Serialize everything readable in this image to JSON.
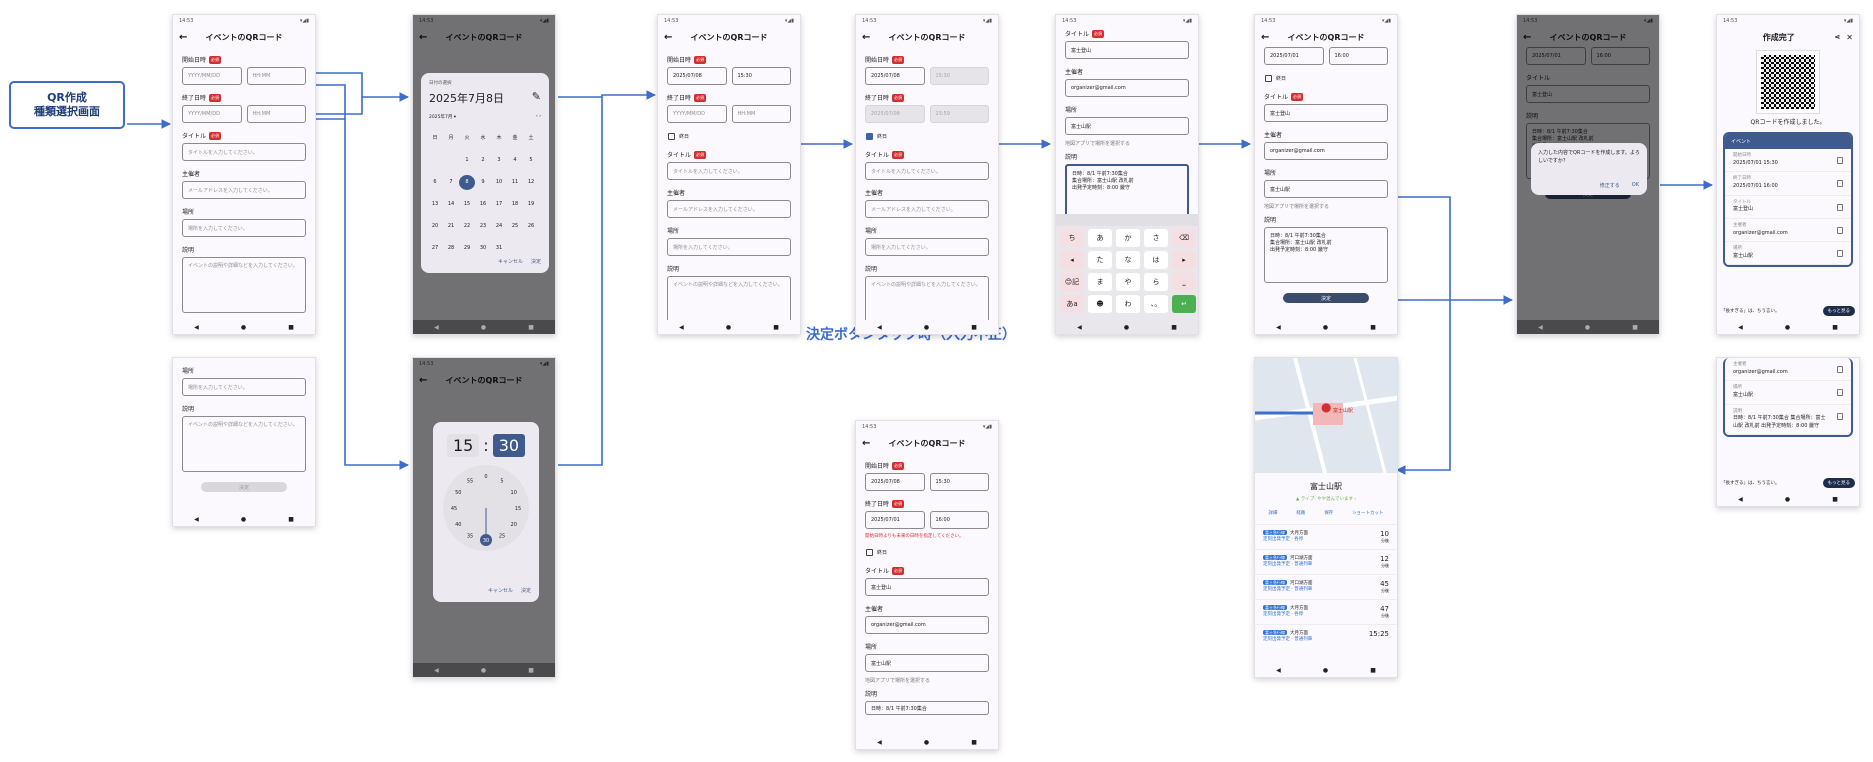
{
  "start_label": [
    "QR作成",
    "種類選択画面"
  ],
  "note": "決定ボタンタップ時（入力不正）",
  "common": {
    "status_time": "14:53",
    "title": "イベントのQRコード",
    "back": "←",
    "nav": [
      "◀",
      "●",
      "■"
    ],
    "required": "必須",
    "start_label": "開始日時",
    "end_label": "終了日時",
    "title_label": "タイトル",
    "organizer_label": "主催者",
    "place_label": "場所",
    "desc_label": "説明",
    "allday": "終日",
    "maplink": "地図アプリで場所を選択する",
    "date_ph": "YYYY/MM/DD",
    "time_ph": "HH:MM",
    "title_ph": "タイトルを入力してください。",
    "org_ph": "メールアドレスを入力してください。",
    "place_ph": "場所を入力してください。",
    "desc_ph": "イベントの説明や詳細などを入力してください。",
    "decide": "決定"
  },
  "values": {
    "start_date": "2025/07/08",
    "start_time": "15:30",
    "end_date": "2025/07/08",
    "end_time": "23:59",
    "end_date_bad": "2025/07/01",
    "end_time_bad": "16:00",
    "title": "富士登山",
    "organizer": "organizer@gmail.com",
    "place": "富士山駅",
    "desc": [
      "日時：8/1 午前7:30集合",
      "集合場所：富士山駅 改札前",
      "出発予定時刻：8:00 厳守"
    ],
    "error": "開始日時よりも未来の日時を指定してください。",
    "desc_short": "日時：8/1 午前7:30集合"
  },
  "date_picker": {
    "heading": "日付の選択",
    "date": "2025年7月8日",
    "month": "2025年7月 ▾",
    "weekdays": [
      "日",
      "月",
      "火",
      "水",
      "木",
      "金",
      "土"
    ],
    "weeks": [
      [
        "",
        "",
        "1",
        "2",
        "3",
        "4",
        "5"
      ],
      [
        "6",
        "7",
        "8",
        "9",
        "10",
        "11",
        "12"
      ],
      [
        "13",
        "14",
        "15",
        "16",
        "17",
        "18",
        "19"
      ],
      [
        "20",
        "21",
        "22",
        "23",
        "24",
        "25",
        "26"
      ],
      [
        "27",
        "28",
        "29",
        "30",
        "31",
        "",
        ""
      ]
    ],
    "selected": "8",
    "cancel": "キャンセル",
    "ok": "決定"
  },
  "time_picker": {
    "hour": "15",
    "minute": "30",
    "dial": [
      "0",
      "5",
      "10",
      "15",
      "20",
      "25",
      "30",
      "35",
      "40",
      "45",
      "50",
      "55"
    ],
    "cancel": "キャンセル",
    "ok": "決定"
  },
  "keyboard": {
    "rows": [
      [
        "ち",
        "あ",
        "か",
        "さ",
        "⌫"
      ],
      [
        "◂",
        "た",
        "な",
        "は",
        "▸"
      ],
      [
        "😊記",
        "ま",
        "や",
        "ら",
        "⎵"
      ],
      [
        "あa",
        "☻",
        "わ",
        "、。",
        "↵"
      ]
    ]
  },
  "confirm_dialog": {
    "text": "入力した内容でQRコードを作成します。よろしいですか？",
    "cancel": "修正する",
    "ok": "OK"
  },
  "complete": {
    "title": "作成完了",
    "message": "QRコードを作成しました。",
    "card_title": "イベント",
    "items": [
      {
        "k": "開始日時",
        "v": "2025/07/01 15:30"
      },
      {
        "k": "終了日時",
        "v": "2025/07/01 16:00"
      },
      {
        "k": "タイトル",
        "v": "富士登山"
      },
      {
        "k": "主催者",
        "v": "organizer@gmail.com"
      },
      {
        "k": "場所",
        "v": "富士山駅"
      }
    ],
    "items2": [
      {
        "k": "主催者",
        "v": "organizer@gmail.com"
      },
      {
        "k": "場所",
        "v": "富士山駅"
      },
      {
        "k": "説明",
        "v": "日時：8/1 午前7:30集合 集合場所：富士山駅 改札前 出発予定時刻：8:00 厳守"
      }
    ],
    "toast": "「長すぎる」は、ちう言い。",
    "toast_btn": "もっと見る",
    "toast_tag": "テスト広告"
  },
  "map": {
    "place": "富士山駅",
    "pin_label": "富士山駅",
    "sub": "▲ ライブ: やや混んでいます ›",
    "actions": [
      "詳細",
      "経路",
      "保存",
      "ショートカット"
    ],
    "routes": [
      {
        "line": "富士急行線",
        "dest": "大月方面",
        "note": "定刻出発予定 · 各停",
        "time": "10",
        "unit": "分後"
      },
      {
        "line": "富士急行線",
        "dest": "河口湖方面",
        "note": "定刻出発予定 · 普通列車",
        "time": "12",
        "unit": "分後"
      },
      {
        "line": "富士急行線",
        "dest": "河口湖方面",
        "note": "定刻出発予定 · 普通列車",
        "time": "45",
        "unit": "分後"
      },
      {
        "line": "富士急行線",
        "dest": "大月方面",
        "note": "定刻出発予定 · 各停",
        "time": "47",
        "unit": "分後"
      },
      {
        "line": "富士急行線",
        "dest": "大月方面",
        "note": "定刻出発予定 · 普通列車",
        "time": "15:25",
        "unit": ""
      }
    ]
  },
  "colors": {
    "accent": "#3d6ccc",
    "required": "#d32f2f",
    "primary": "#3f5a8c"
  }
}
